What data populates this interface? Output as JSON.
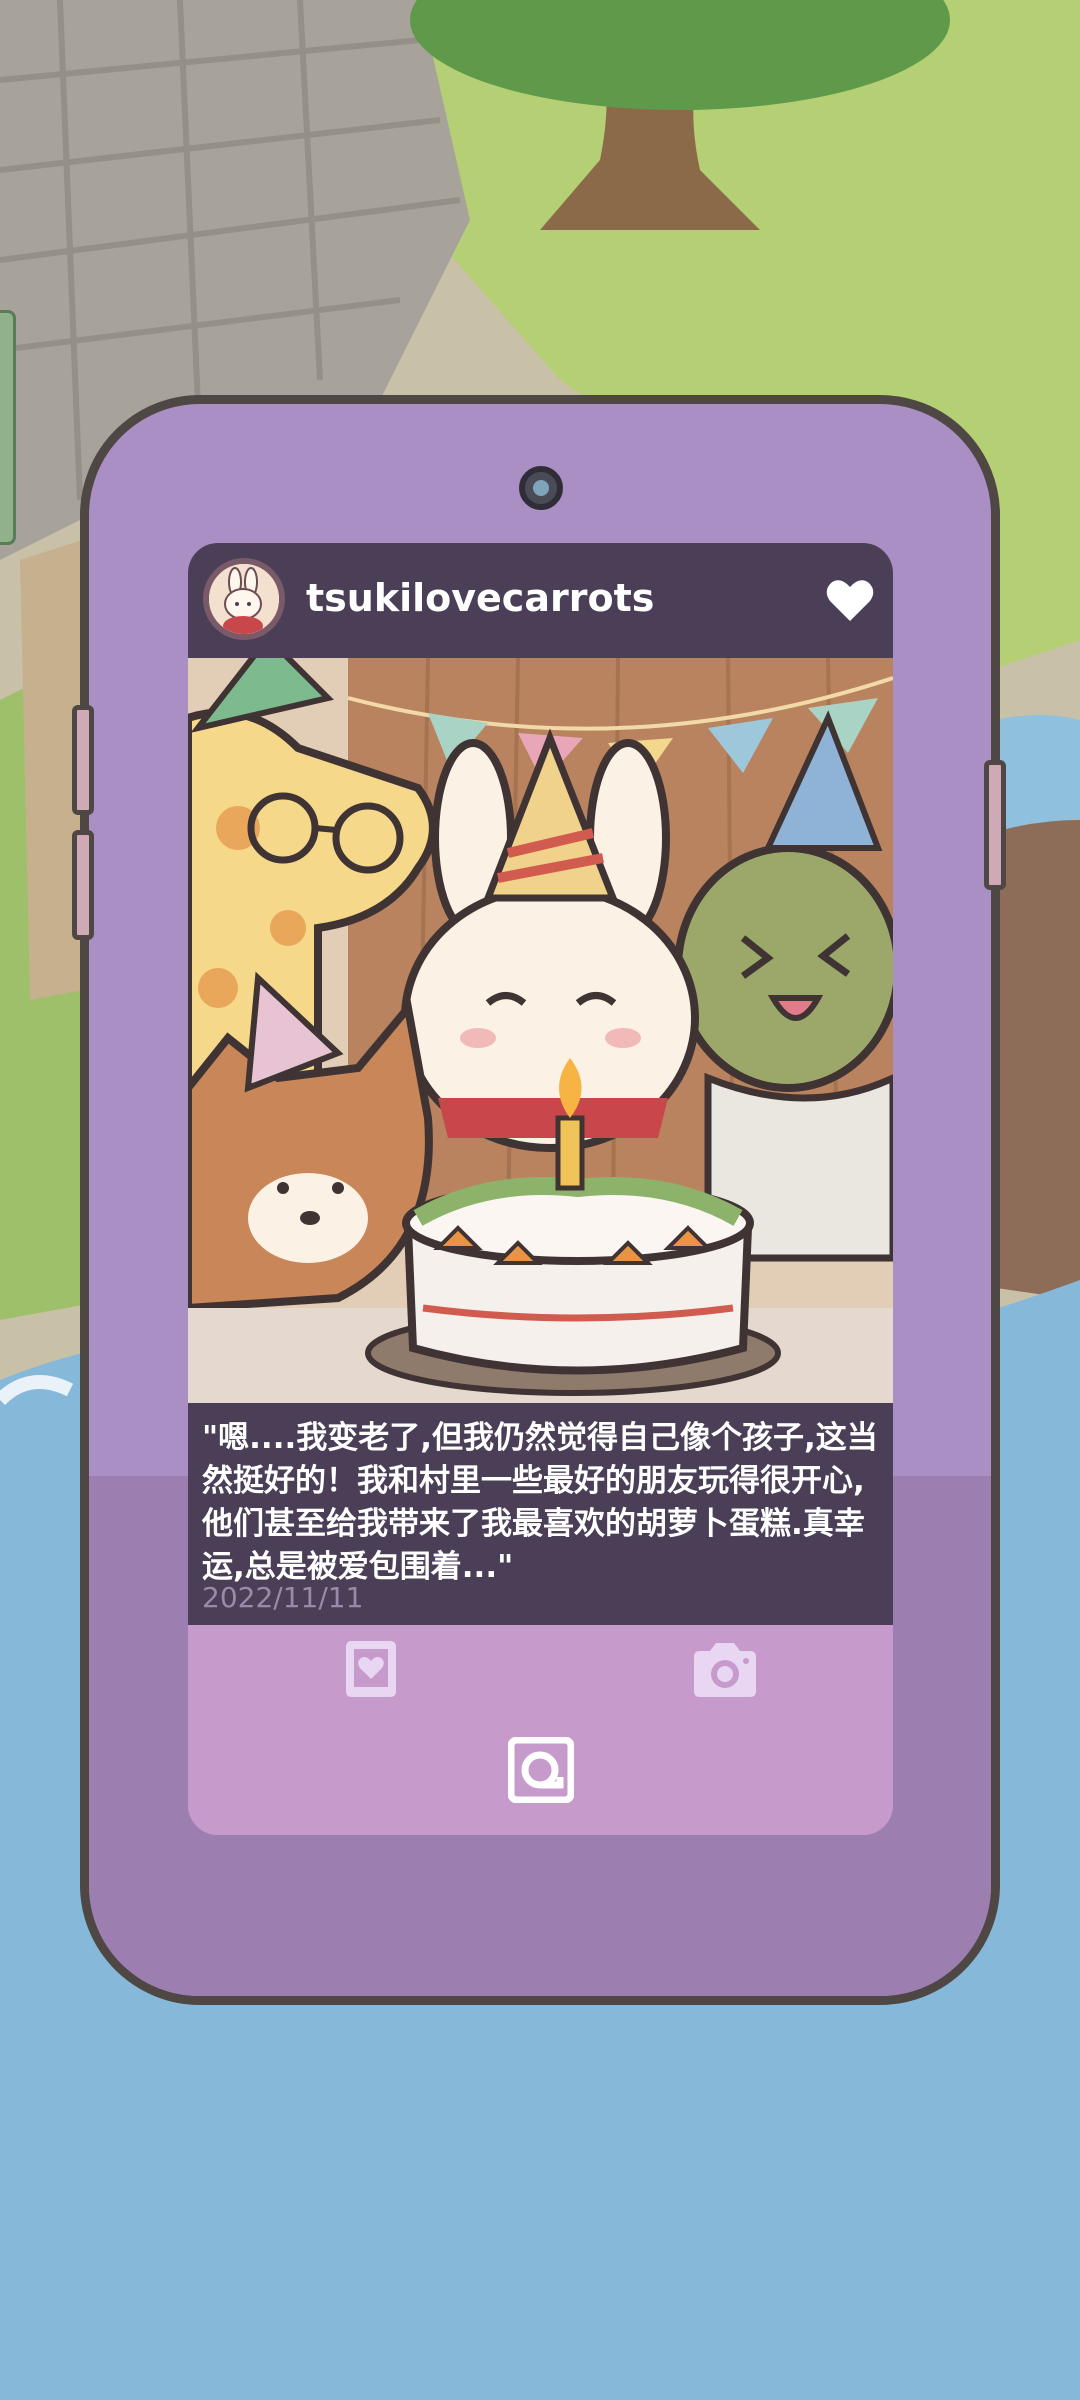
{
  "post": {
    "username": "tsukilovecarrots",
    "caption": "\"嗯....我变老了,但我仍然觉得自己像个孩子,这当然挺好的！我和村里一些最好的朋友玩得很开心,他们甚至给我带来了我最喜欢的胡萝卜蛋糕.真幸运,总是被爱包围着...\"",
    "date": "2022/11/11",
    "liked": true
  },
  "icons": {
    "like": "heart-icon",
    "album": "photo-album-icon",
    "camera": "camera-icon",
    "profile": "profile-view-icon",
    "avatar": "bunny-avatar"
  },
  "colors": {
    "phone_body": "#a98fc4",
    "header_bg": "#4a3f57",
    "screen_bg": "#c69bcc",
    "icon_light": "#e9d6f2"
  }
}
